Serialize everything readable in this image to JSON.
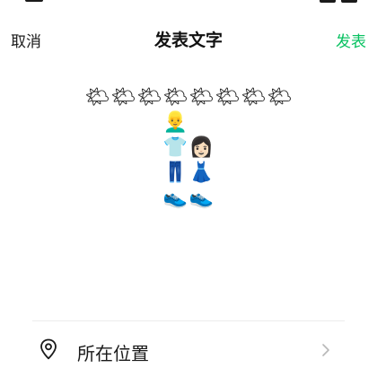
{
  "header": {
    "cancel_label": "取消",
    "title": "发表文字",
    "publish_label": "发表",
    "publish_color": "#07c160"
  },
  "post": {
    "lines": [
      [
        "🌤",
        "🌤",
        "🌤",
        "🌤",
        "🌤",
        "🌤",
        "🌤",
        "🌤"
      ],
      [
        "👱‍♂️",
        " "
      ],
      [
        "👕",
        "👩🏻"
      ],
      [
        "👖",
        "👗"
      ],
      [
        "👟",
        "👟"
      ]
    ]
  },
  "location": {
    "label": "所在位置",
    "icon": "location-pin-icon",
    "chevron": "chevron-right-icon"
  }
}
